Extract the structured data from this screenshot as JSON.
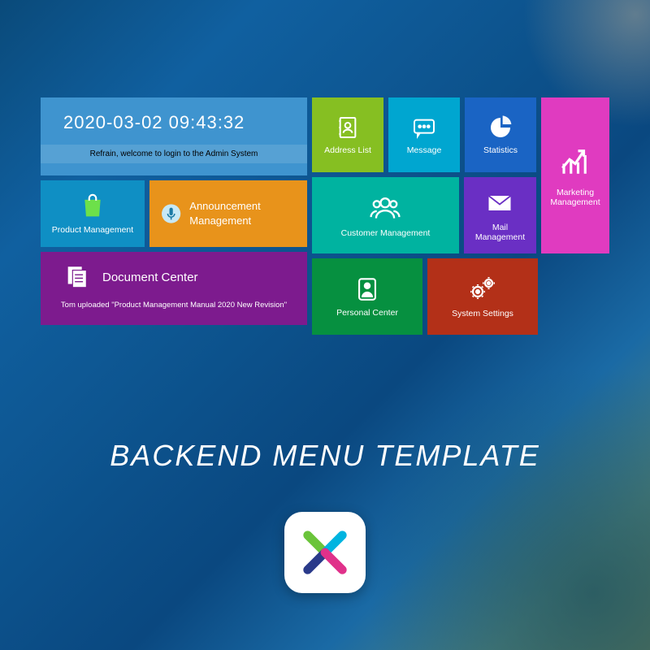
{
  "datetime": "2020-03-02  09:43:32",
  "welcome": "Refrain, welcome to login to the Admin System",
  "tiles": {
    "product": "Product Management",
    "announcement": "Announcement Management",
    "document_title": "Document Center",
    "document_sub": "Tom uploaded \"Product Management Manual 2020 New Revision\"",
    "address": "Address List",
    "message": "Message",
    "statistics": "Statistics",
    "marketing": "Marketing Management",
    "customer": "Customer Management",
    "mail": "Mail Management",
    "personal": "Personal Center",
    "system": "System Settings"
  },
  "title": "BACKEND MENU TEMPLATE"
}
